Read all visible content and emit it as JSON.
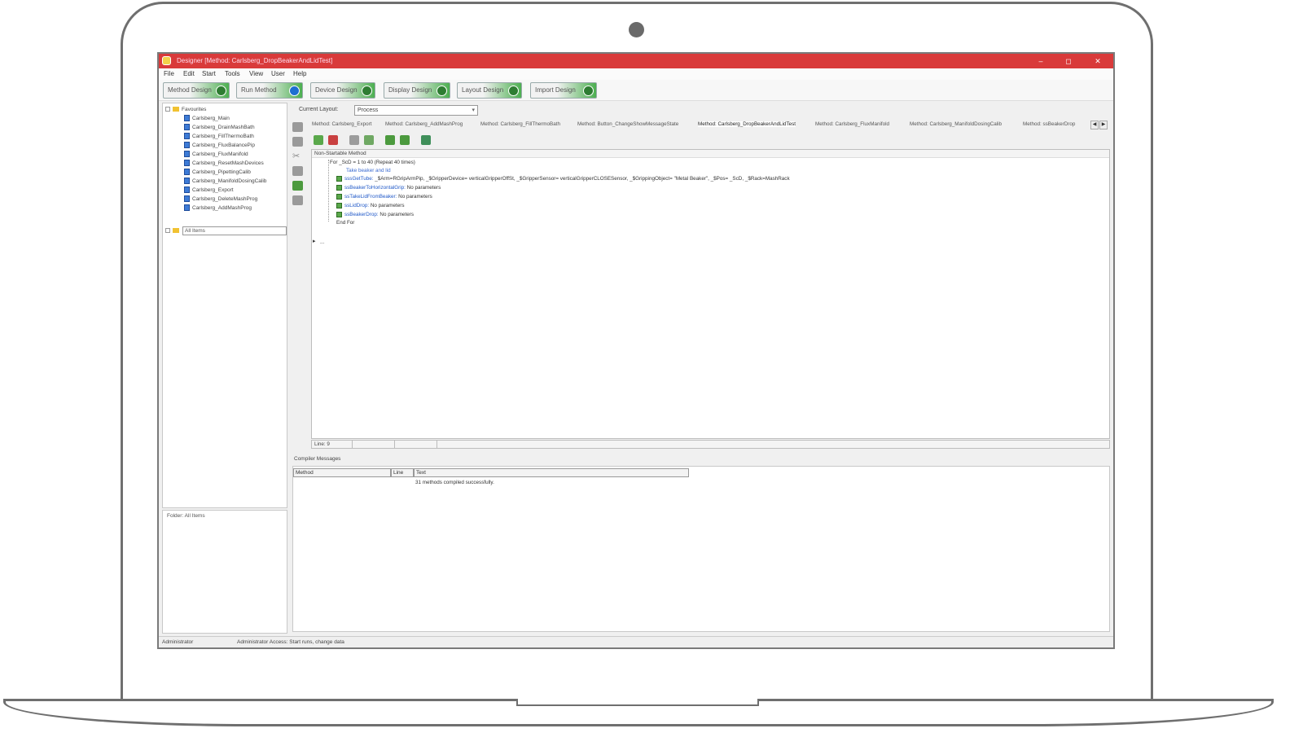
{
  "window": {
    "title": "Designer [Method: Carlsberg_DropBeakerAndLidTest]",
    "controls": {
      "minimize": "–",
      "maximize": "◻",
      "close": "✕"
    },
    "accent_color": "#d93a3a"
  },
  "menu": [
    "File",
    "Edit",
    "Start",
    "Tools",
    "View",
    "User",
    "Help"
  ],
  "toolbar": {
    "buttons": [
      "Method Design",
      "Run Method",
      "Device Design",
      "Display Design",
      "Layout Design",
      "Import Design"
    ]
  },
  "tree": {
    "root": "Favourites",
    "items": [
      "Carlsberg_Main",
      "Carlsberg_DrainMashBath",
      "Carlsberg_FillThermoBath",
      "Carlsberg_FluxBalancePip",
      "Carlsberg_FluxManifold",
      "Carlsberg_ResetMashDevices",
      "Carlsberg_PipettingCalib",
      "Carlsberg_ManifoldDosingCalib",
      "Carlsberg_Export",
      "Carlsberg_DeleteMashProg",
      "Carlsberg_AddMashProg"
    ],
    "all_items": "All Items",
    "folder_label": "Folder: All Items"
  },
  "layout": {
    "label": "Current Layout:",
    "value": "Process"
  },
  "tabs": [
    "Method: Carlsberg_Export",
    "Method: Carlsberg_AddMashProg",
    "Method: Carlsberg_FillThermoBath",
    "Method: Button_ChangeShowMessageState",
    "Method: Carlsberg_DropBeakerAndLidTest",
    "Method: Carlsberg_FluxManifold",
    "Method: Carlsberg_ManifoldDosingCalib",
    "Method: ssBeakerDrop"
  ],
  "tab_nav": {
    "prev": "◀",
    "next": "▶"
  },
  "editor": {
    "header": "Non-Startable Method",
    "for_line": "For _ScD = 1 to 40 (Repeat 40 times)",
    "comment": "Take beaker and lid",
    "steps": [
      {
        "name": "sssGetTube:",
        "params": "_$Arm=RGripArmPip, _$GripperDevice= verticalGripperOffSt, _$GripperSensor= verticalGripperCLOSESensor, _$GrippingObject= \"Metal Beaker\", _$Pos= _ScD, _$Rack=MashRack"
      },
      {
        "name": "ssBeakerToHorizontalGrip:",
        "params": "No parameters"
      },
      {
        "name": "ssTakeLidFromBeaker:",
        "params": "No parameters"
      },
      {
        "name": "ssLidDrop:",
        "params": "No parameters"
      },
      {
        "name": "ssBeakerDrop:",
        "params": "No parameters"
      }
    ],
    "end_for": "End For",
    "ellipsis": "...",
    "status": "Line: 9"
  },
  "compiler": {
    "label": "Compiler Messages",
    "columns": [
      "Method",
      "Line",
      "Text"
    ],
    "message": "31 methods compiled successfully."
  },
  "statusbar": {
    "user": "Administrator",
    "access": "Administrator Access: Start runs, change data"
  }
}
